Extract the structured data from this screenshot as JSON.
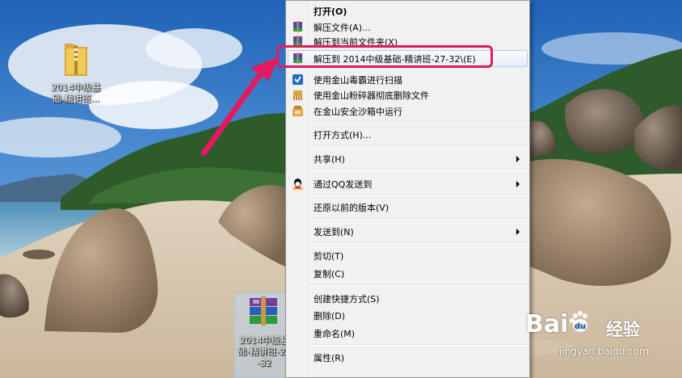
{
  "desktop": {
    "folder_icon": {
      "label": "2014中级基础-精讲班..."
    },
    "rar_icon": {
      "label": "2014中级基础-精讲班-27-32"
    }
  },
  "context_menu": {
    "items": [
      {
        "label": "打开(O)",
        "bold": true,
        "icon": "none"
      },
      {
        "label": "解压文件(A)...",
        "icon": "winrar-icon"
      },
      {
        "label": "解压到当前文件夹(X)",
        "icon": "winrar-icon"
      },
      {
        "label": "解压到 2014中级基础-精讲班-27-32\\(E)",
        "icon": "winrar-icon",
        "highlighted": true
      },
      {
        "label": "使用金山毒霸进行扫描",
        "icon": "antivirus-icon"
      },
      {
        "label": "使用金山粉碎器彻底删除文件",
        "icon": "shredder-icon"
      },
      {
        "label": "在金山安全沙箱中运行",
        "icon": "sandbox-icon"
      },
      {
        "label": "打开方式(H)...",
        "icon": "none"
      },
      {
        "label": "共享(H)",
        "icon": "none",
        "submenu": true
      },
      {
        "label": "通过QQ发送到",
        "icon": "qq-icon",
        "submenu": true
      },
      {
        "label": "还原以前的版本(V)",
        "icon": "none"
      },
      {
        "label": "发送到(N)",
        "icon": "none",
        "submenu": true
      },
      {
        "label": "剪切(T)",
        "icon": "none"
      },
      {
        "label": "复制(C)",
        "icon": "none"
      },
      {
        "label": "创建快捷方式(S)",
        "icon": "none"
      },
      {
        "label": "删除(D)",
        "icon": "none"
      },
      {
        "label": "重命名(M)",
        "icon": "none"
      },
      {
        "label": "属性(R)",
        "icon": "none"
      }
    ]
  },
  "annotation": {
    "highlight_color": "#e5195f"
  },
  "watermark": {
    "brand": "Bai",
    "brand_suffix": "du",
    "product": "经验",
    "url": "jingyan.baidu.com"
  }
}
